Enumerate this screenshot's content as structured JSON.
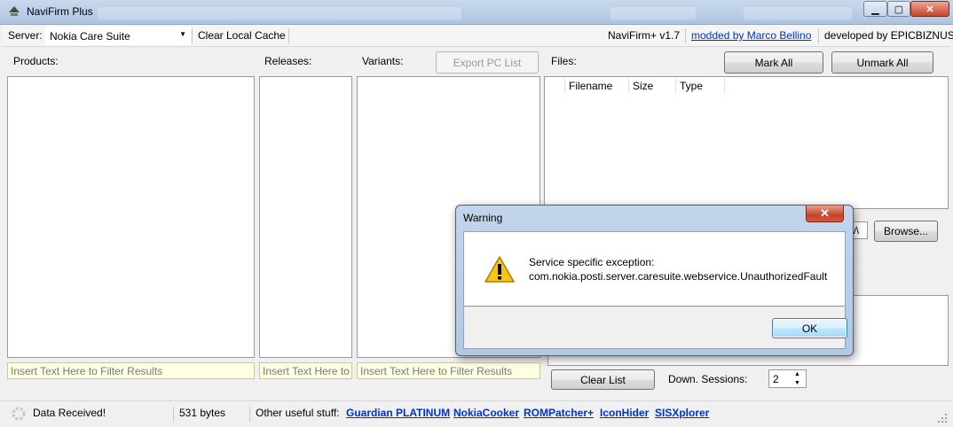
{
  "window": {
    "title": "NaviFirm Plus",
    "minimize": "▁",
    "maximize": "▢",
    "close": "✕"
  },
  "toolbar": {
    "server_label": "Server:",
    "server_value": "Nokia Care Suite",
    "clear_cache": "Clear Local Cache",
    "version": "NaviFirm+ v1.7",
    "modded_by": "modded by Marco Bellino",
    "developed_by": "developed by EPICBIZNUS"
  },
  "panels": {
    "products_label": "Products:",
    "releases_label": "Releases:",
    "variants_label": "Variants:",
    "files_label": "Files:",
    "export_button": "Export PC List",
    "mark_all": "Mark All",
    "unmark_all": "Unmark All",
    "filter_placeholder": "Insert Text Here to Filter Results",
    "filter_placeholder_short": "Insert Text Here to Fi"
  },
  "files_table": {
    "columns": [
      "Filename",
      "Size",
      "Type"
    ]
  },
  "download": {
    "path_fragment": "w\\",
    "browse": "Browse...",
    "clear_list": "Clear List",
    "sessions_label": "Down. Sessions:",
    "sessions_value": "2"
  },
  "status": {
    "message": "Data Received!",
    "bytes": "531 bytes",
    "other_label": "Other useful stuff:",
    "links": [
      "Guardian PLATINUM",
      "NokiaCooker",
      "ROMPatcher+",
      "IconHider",
      "SISXplorer"
    ]
  },
  "dialog": {
    "title": "Warning",
    "close": "✕",
    "line1": "Service specific exception:",
    "line2": "com.nokia.posti.server.caresuite.webservice.UnauthorizedFault",
    "ok": "OK"
  },
  "colors": {
    "link": "#0033cc",
    "filter_bg": "#ffffe1",
    "title_bar": "#b8cde6"
  }
}
